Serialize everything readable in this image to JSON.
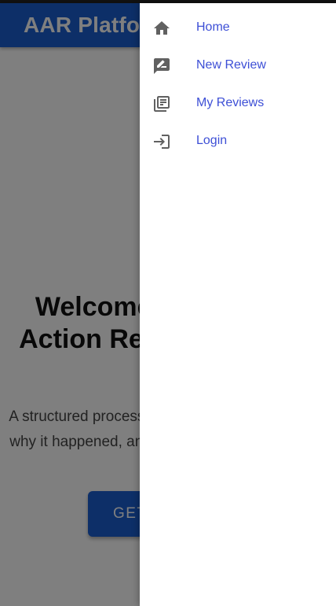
{
  "appbar": {
    "title": "AAR Platform"
  },
  "hero": {
    "title": "Welcome to the After Action Review Platform",
    "subtitle": "A structured process to analyze what happened, why it happened, and how it can be done better.",
    "cta_label": "GET STARTED"
  },
  "drawer": {
    "items": [
      {
        "label": "Home",
        "icon": "home-icon"
      },
      {
        "label": "New Review",
        "icon": "rate-review-icon"
      },
      {
        "label": "My Reviews",
        "icon": "library-books-icon"
      },
      {
        "label": "Login",
        "icon": "login-icon"
      }
    ]
  },
  "colors": {
    "primary": "#1a5fd0",
    "drawer_link": "#3d4fd6",
    "icon": "#616161",
    "scrim": "rgba(0,0,0,0.5)"
  }
}
